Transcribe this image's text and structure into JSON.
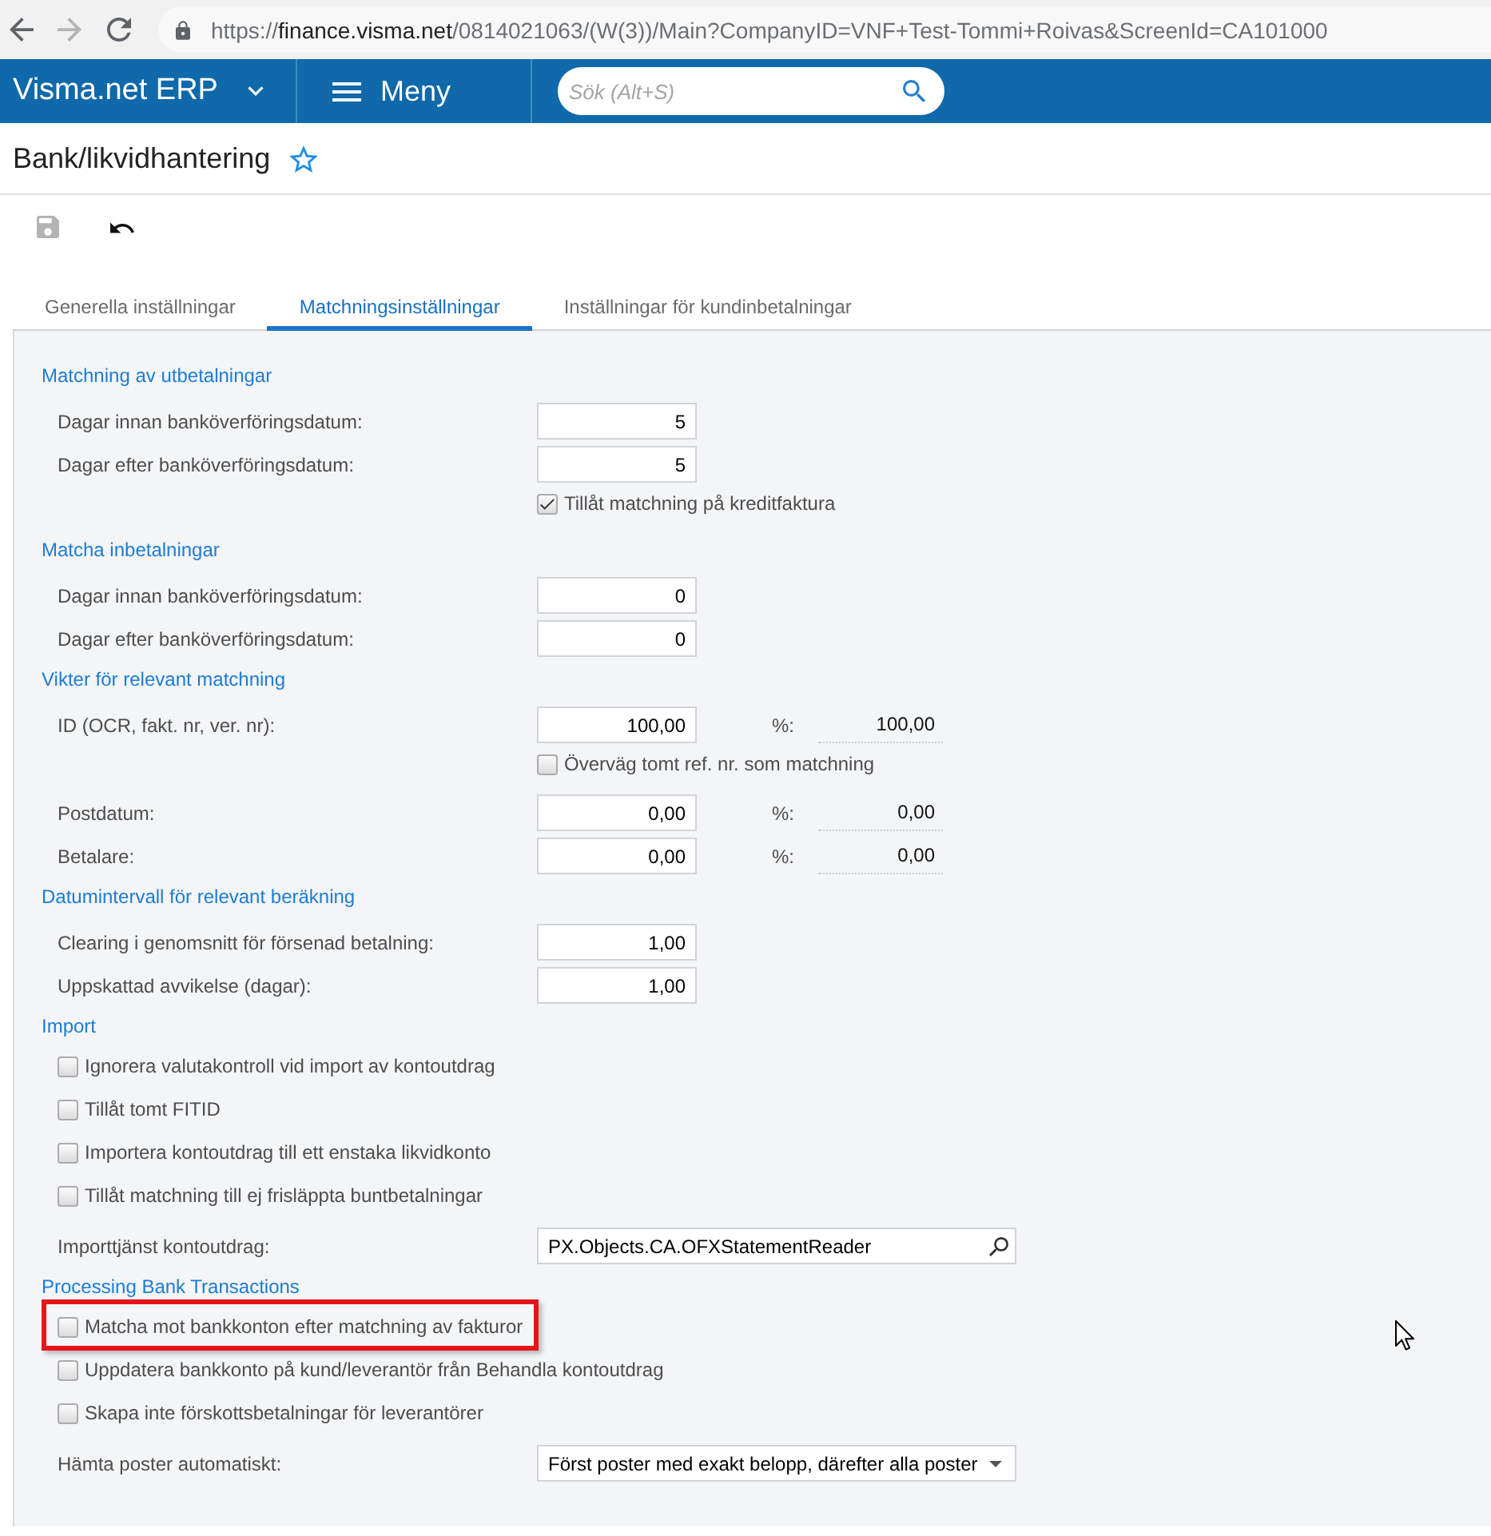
{
  "browser": {
    "address": {
      "scheme": "https://",
      "host": "finance.visma.net",
      "path": "/0814021063/(W(3))/Main?CompanyID=VNF+Test-Tommi+Roivas&ScreenId=CA101000"
    }
  },
  "header": {
    "product": "Visma.net ERP",
    "menu": "Meny",
    "search": {
      "placeholder": "Sök (Alt+S)"
    }
  },
  "page": {
    "title": "Bank/likvidhantering",
    "favorite": false
  },
  "toolbar": [
    {
      "kind": "save",
      "disabled": true
    },
    {
      "kind": "undo",
      "disabled": false
    }
  ],
  "tabs": [
    {
      "label": "Generella inställningar",
      "selected": false
    },
    {
      "label": "Matchningsinställningar",
      "selected": true
    },
    {
      "label": "Inställningar för kundinbetalningar",
      "selected": false
    }
  ],
  "sections": [
    {
      "title": "Matchning av utbetalningar",
      "rows": [
        {
          "kind": "number",
          "label": "Dagar innan banköverföringsdatum:",
          "value": "5"
        },
        {
          "kind": "number",
          "label": "Dagar efter banköverföringsdatum:",
          "value": "5"
        },
        {
          "kind": "inline_checkbox",
          "label": "Tillåt matchning på kreditfaktura",
          "checked": true
        }
      ]
    },
    {
      "title": "Matcha inbetalningar",
      "rows": [
        {
          "kind": "number",
          "label": "Dagar innan banköverföringsdatum:",
          "value": "0"
        },
        {
          "kind": "number",
          "label": "Dagar efter banköverföringsdatum:",
          "value": "0"
        }
      ]
    },
    {
      "title": "Vikter för relevant matchning",
      "rows": [
        {
          "kind": "weight",
          "label": "ID (OCR, fakt. nr, ver. nr):",
          "value": "100,00",
          "percent_label": "%:",
          "percent": "100,00"
        },
        {
          "kind": "inline_checkbox",
          "label": "Överväg tomt ref. nr. som matchning",
          "checked": false
        },
        {
          "kind": "weight",
          "label": "Postdatum:",
          "value": "0,00",
          "percent_label": "%:",
          "percent": "0,00"
        },
        {
          "kind": "weight",
          "label": "Betalare:",
          "value": "0,00",
          "percent_label": "%:",
          "percent": "0,00"
        }
      ]
    },
    {
      "title": "Datumintervall för relevant beräkning",
      "rows": [
        {
          "kind": "number",
          "label": "Clearing i genomsnitt för försenad betalning:",
          "value": "1,00"
        },
        {
          "kind": "number",
          "label": "Uppskattad avvikelse (dagar):",
          "value": "1,00"
        }
      ]
    },
    {
      "title": "Import",
      "rows": [
        {
          "kind": "checkbox",
          "label": "Ignorera valutakontroll vid import av kontoutdrag",
          "checked": false
        },
        {
          "kind": "checkbox",
          "label": "Tillåt tomt FITID",
          "checked": false
        },
        {
          "kind": "checkbox",
          "label": "Importera kontoutdrag till ett enstaka likvidkonto",
          "checked": false
        },
        {
          "kind": "checkbox",
          "label": "Tillåt matchning till ej frisläppta buntbetalningar",
          "checked": false
        },
        {
          "kind": "lookup",
          "label": "Importtjänst kontoutdrag:",
          "value": "PX.Objects.CA.OFXStatementReader"
        }
      ]
    },
    {
      "title": "Processing Bank Transactions",
      "rows": [
        {
          "kind": "checkbox",
          "label": "Matcha mot bankkonton efter matchning av fakturor",
          "checked": false,
          "highlighted": true
        },
        {
          "kind": "checkbox",
          "label": "Uppdatera bankkonto på kund/leverantör från Behandla kontoutdrag",
          "checked": false,
          "highlighted": false
        },
        {
          "kind": "checkbox",
          "label": "Skapa inte förskottsbetalningar för leverantörer",
          "checked": false,
          "highlighted": false
        },
        {
          "kind": "select",
          "label": "Hämta poster automatiskt:",
          "value": "Först poster med exakt belopp, därefter alla poster",
          "highlighted": false
        }
      ]
    }
  ]
}
